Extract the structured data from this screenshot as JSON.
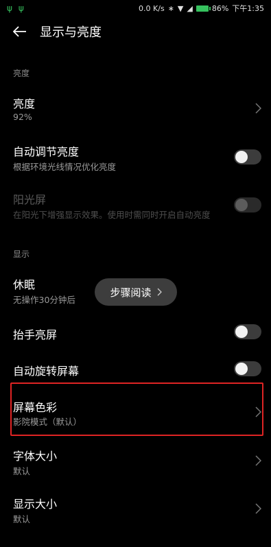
{
  "status_bar": {
    "left_icons": [
      "usb-icon",
      "usb-icon"
    ],
    "speed": "0.0 K/s",
    "battery": "86%",
    "time": "下午1:35"
  },
  "app_bar": {
    "back_icon": "arrow-left-icon",
    "title": "显示与亮度"
  },
  "sections": {
    "brightness_header": "亮度",
    "display_header": "显示"
  },
  "rows": {
    "brightness": {
      "title": "亮度",
      "subtitle": "92%"
    },
    "auto_brightness": {
      "title": "自动调节亮度",
      "subtitle": "根据环境光线情况优化亮度",
      "enabled": false
    },
    "sunlight_screen": {
      "title": "阳光屏",
      "subtitle": "在阳光下增强显示效果。使用时需同时开启自动亮度",
      "enabled": false,
      "disabled": true
    },
    "sleep": {
      "title": "休眠",
      "subtitle": "无操作30分钟后"
    },
    "lift_to_wake": {
      "title": "抬手亮屏",
      "enabled": false
    },
    "auto_rotate": {
      "title": "自动旋转屏幕",
      "enabled": false
    },
    "screen_color": {
      "title": "屏幕色彩",
      "subtitle": "影院模式（默认）"
    },
    "font_size": {
      "title": "字体大小",
      "subtitle": "默认"
    },
    "display_size": {
      "title": "显示大小",
      "subtitle": "默认"
    }
  },
  "toast": {
    "label": "步骤阅读",
    "icon": "chevron-right-icon"
  },
  "colors": {
    "background": "#000000",
    "highlight": "#e02424",
    "battery": "#36c25e"
  }
}
